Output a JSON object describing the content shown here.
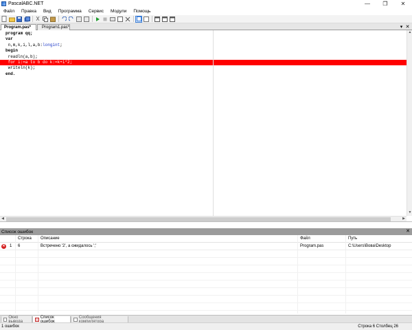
{
  "window": {
    "title": "PascalABC.NET"
  },
  "menu": [
    "Файл",
    "Правка",
    "Вид",
    "Программа",
    "Сервис",
    "Модули",
    "Помощь"
  ],
  "tabs": {
    "active": "Program.pas*",
    "inactive": "Program1.pas*"
  },
  "code": [
    {
      "segments": [
        {
          "t": "program qq;",
          "c": "kw"
        }
      ]
    },
    {
      "segments": [
        {
          "t": "var",
          "c": "kw"
        }
      ]
    },
    {
      "segments": [
        {
          "t": " n,m,k,i,l,a,b:",
          "c": ""
        },
        {
          "t": "longint",
          "c": "tp"
        },
        {
          "t": ";",
          "c": ""
        }
      ]
    },
    {
      "segments": [
        {
          "t": "begin",
          "c": "kw"
        }
      ]
    },
    {
      "segments": [
        {
          "t": " readln(a,b);",
          "c": ""
        }
      ]
    },
    {
      "segments": [
        {
          "t": " for i:=a to b do k:=k+i*2;",
          "c": ""
        }
      ],
      "highlight": true
    },
    {
      "segments": [
        {
          "t": " writeln(k);",
          "c": ""
        }
      ]
    },
    {
      "segments": [
        {
          "t": "end.",
          "c": "kw"
        }
      ]
    }
  ],
  "errors": {
    "panel_title": "Список ошибок",
    "headers": {
      "line": "Строка",
      "description": "Описание",
      "file": "Файл",
      "path": "Путь"
    },
    "rows": [
      {
        "num": "1",
        "line": "6",
        "description": "Встречено '2', а ожидалось ';'",
        "file": "Program.pas",
        "path": "C:\\Users\\Вова\\Desktop"
      }
    ]
  },
  "bottom_tabs": [
    "Окно вывода",
    "Список ошибок",
    "Сообщения компилятора"
  ],
  "status": {
    "left": "1 ошибок",
    "right": "Строка  6  Столбец  26"
  },
  "colors": {
    "highlight": "#ff0000",
    "keyword_type": "#1e39c8",
    "panel_header": "#9b9b9b"
  }
}
